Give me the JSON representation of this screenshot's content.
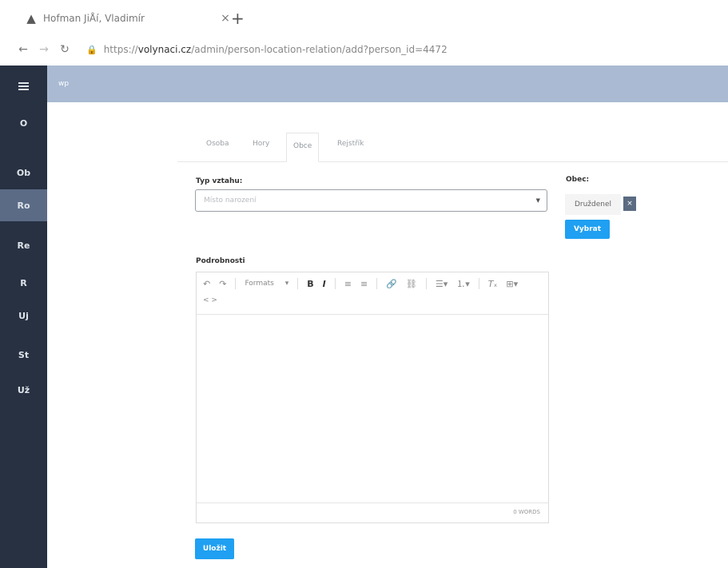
{
  "browser": {
    "tab_title": "Hofman JiÅí, Vladimír",
    "tab_close": "×",
    "new_tab": "+",
    "url_scheme": "https://",
    "url_host": "volynaci.cz",
    "url_path": "/admin/person-location-relation/add?person_id=4472"
  },
  "sidebar": {
    "items": [
      {
        "label": "O"
      },
      {
        "label": "Ob"
      },
      {
        "label": "Ro",
        "active": true
      },
      {
        "label": "Re"
      },
      {
        "label": "R"
      },
      {
        "label": "Uj"
      },
      {
        "label": "St"
      },
      {
        "label": "Už"
      }
    ]
  },
  "topbar": {
    "text": "wp"
  },
  "tabs": [
    {
      "label": "Osoba"
    },
    {
      "label": "Hory"
    },
    {
      "label": "Obce",
      "active": true
    },
    {
      "label": "Rejstřík"
    }
  ],
  "form": {
    "typ_label": "Typ vztahu:",
    "typ_value": "Místo narození",
    "obec_label": "Obec:",
    "obec_value": "Druždenel",
    "obec_clear": "×",
    "vybrat_label": "Vybrat",
    "podrobnosti_label": "Podrobnosti",
    "editor": {
      "formats_label": "Formats",
      "word_count": "0 WORDS",
      "source_code_icon": "< >"
    },
    "submit_label": "Uložit"
  },
  "colors": {
    "sidebar_bg": "#273142",
    "topbar_bg": "#a9bad2",
    "primary": "#1fa0f2"
  }
}
